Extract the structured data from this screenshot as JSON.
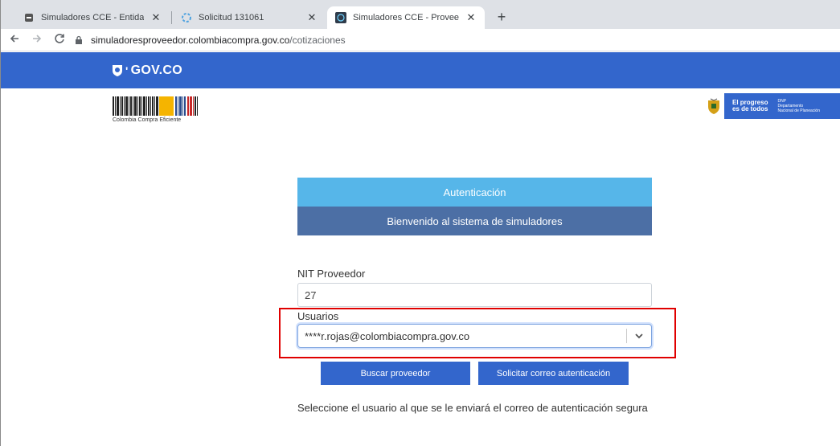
{
  "browser": {
    "tabs": [
      {
        "title": "Simuladores CCE - Entidad",
        "active": false
      },
      {
        "title": "Solicitud 131061",
        "active": false
      },
      {
        "title": "Simuladores CCE - Proveedores",
        "active": true
      }
    ],
    "close_glyph": "✕",
    "new_tab_glyph": "+",
    "url_host": "simuladoresproveedor.colombiacompra.gov.co",
    "url_path": "/cotizaciones"
  },
  "header": {
    "gov_logo_text": "GOV.CO",
    "cce_caption": "Colombia Compra Eficiente",
    "slogan_line1": "El progreso",
    "slogan_line2": "es de todos",
    "dnp_line1": "DNP",
    "dnp_line2": "Departamento",
    "dnp_line3": "Nacional de Planeación"
  },
  "auth": {
    "title": "Autenticación",
    "subtitle": "Bienvenido al sistema de simuladores",
    "nit_label": "NIT Proveedor",
    "nit_value": "27",
    "users_label": "Usuarios",
    "users_selected": "****r.rojas@colombiacompra.gov.co",
    "search_button": "Buscar proveedor",
    "request_button": "Solicitar correo autenticación",
    "help_text": "Seleccione el usuario al que se le enviará el correo de autenticación segura"
  },
  "colors": {
    "gov_blue": "#3366cc",
    "panel_light": "#56b6e9",
    "panel_dark": "#4c6fa5",
    "highlight": "#e00000"
  }
}
